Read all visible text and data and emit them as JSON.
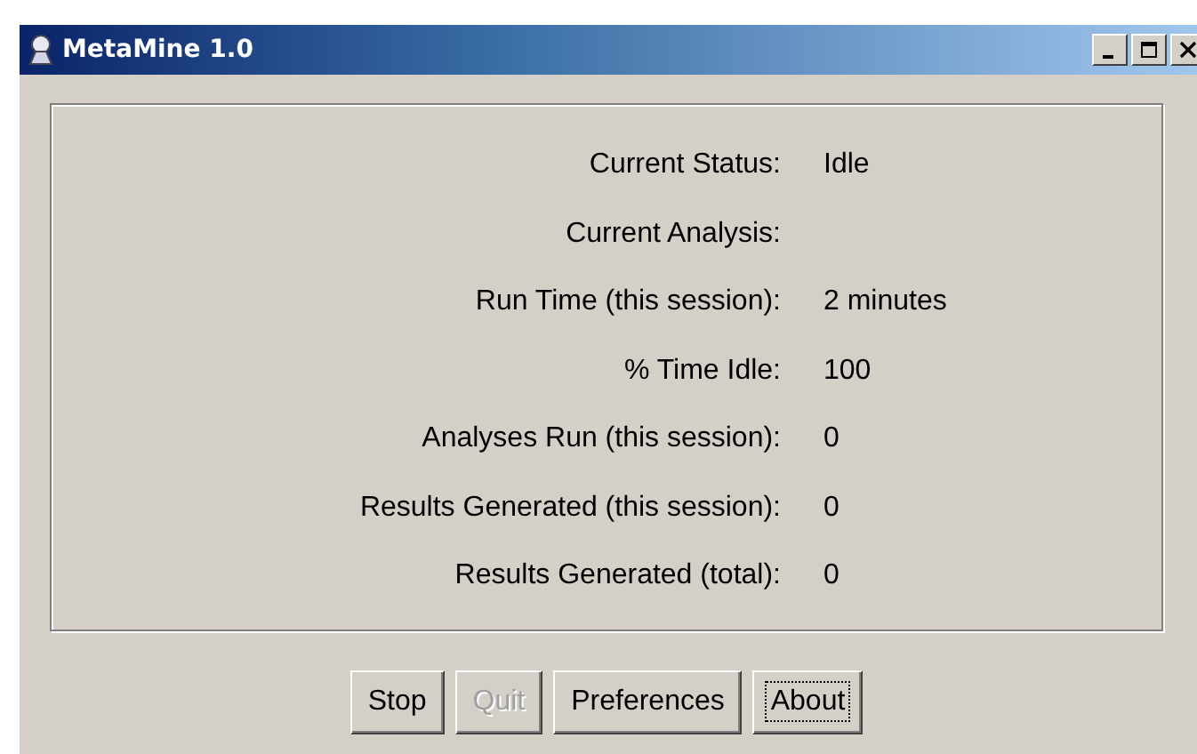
{
  "window": {
    "title": "MetaMine 1.0"
  },
  "fields": [
    {
      "label": "Current Status:",
      "value": "Idle"
    },
    {
      "label": "Current Analysis:"
    },
    {
      "label": "Run Time (this session):",
      "value": "2 minutes"
    },
    {
      "label": "% Time Idle:",
      "value": "100"
    },
    {
      "label": "Analyses Run (this session):",
      "value": "0"
    },
    {
      "label": "Results Generated (this session):",
      "value": "0"
    },
    {
      "label": "Results Generated (total):",
      "value": "0"
    }
  ],
  "buttons": [
    {
      "label": "Stop",
      "disabled": false,
      "focused": false
    },
    {
      "label": "Quit",
      "disabled": true,
      "focused": false
    },
    {
      "label": "Preferences",
      "disabled": false,
      "focused": false
    },
    {
      "label": "About",
      "disabled": false,
      "focused": true
    }
  ]
}
